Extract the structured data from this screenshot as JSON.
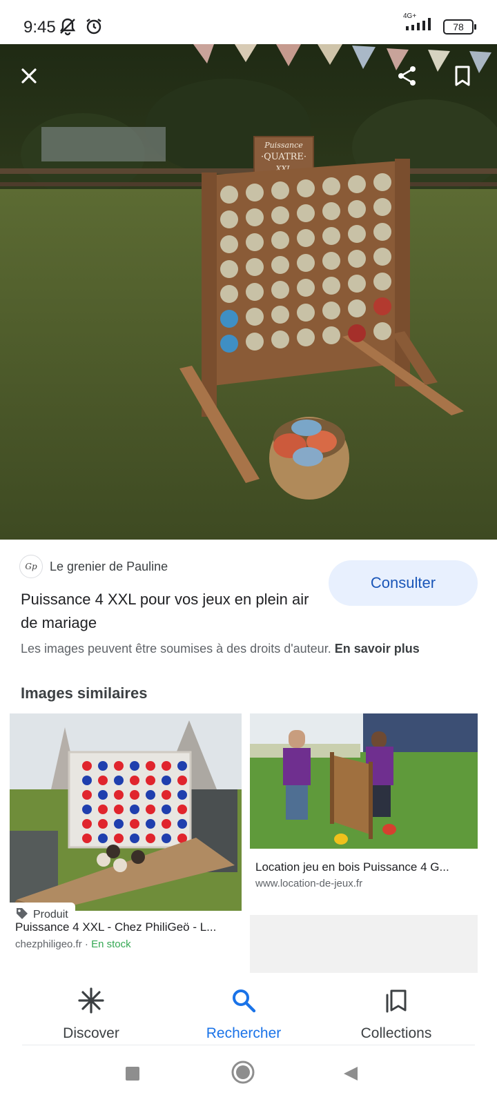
{
  "status_bar": {
    "time": "9:45",
    "network": "4G+",
    "battery": "78"
  },
  "hero": {
    "sign_lines": [
      "Puissance",
      "·QUATRE·",
      "XXL"
    ],
    "icons": {
      "close": "close-icon",
      "share": "share-icon",
      "bookmark": "bookmark-icon"
    }
  },
  "result": {
    "source_logo_text": "Gp",
    "source_name": "Le grenier de Pauline",
    "consult_label": "Consulter",
    "title": "Puissance 4 XXL pour vos jeux en plein air de mariage",
    "copyright_text": "Les images peuvent être soumises à des droits d'auteur. ",
    "learn_more": "En savoir plus"
  },
  "similar": {
    "section_title": "Images similaires",
    "cards": [
      {
        "title": "Puissance 4 XXL - Chez PhiliGeö - L...",
        "domain": "chezphiligeo.fr",
        "separator": " · ",
        "stock": "En stock",
        "chip": "Produit"
      },
      {
        "title": "Location jeu en bois Puissance 4 G...",
        "domain": "www.location-de-jeux.fr"
      }
    ]
  },
  "bottom_nav": {
    "items": [
      {
        "label": "Discover",
        "icon": "asterisk-icon"
      },
      {
        "label": "Rechercher",
        "icon": "search-icon"
      },
      {
        "label": "Collections",
        "icon": "collections-icon"
      }
    ],
    "active": "Rechercher"
  },
  "colors": {
    "accent": "#1a73e8",
    "button_bg": "#e8f0fe",
    "stock_green": "#34a853"
  }
}
